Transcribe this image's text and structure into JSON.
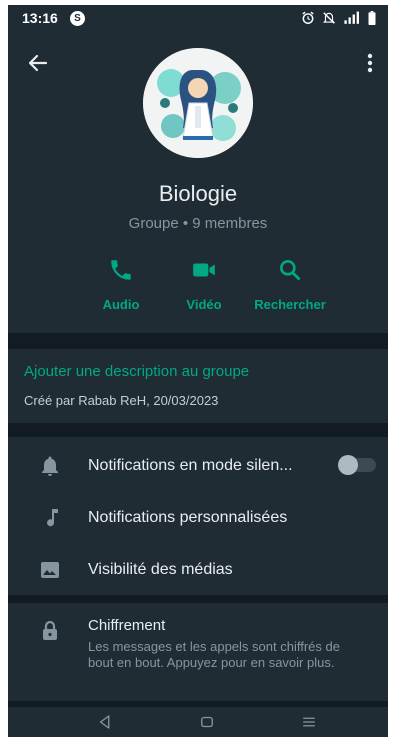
{
  "status_bar": {
    "time": "13:16",
    "s_badge": "S",
    "icons": [
      "alarm-icon",
      "mute-icon",
      "signal-icon",
      "battery-icon"
    ],
    "signal_text": "ᴳₗ"
  },
  "header": {
    "back_icon": "arrow-left-icon",
    "menu_icon": "more-vertical-icon"
  },
  "group": {
    "name": "Biologie",
    "meta": "Groupe • 9 membres"
  },
  "actions": [
    {
      "label": "Audio",
      "icon": "phone-icon"
    },
    {
      "label": "Vidéo",
      "icon": "video-icon"
    },
    {
      "label": "Rechercher",
      "icon": "search-icon"
    }
  ],
  "description": {
    "add_label": "Ajouter une description au groupe",
    "created": "Créé par Rabab ReH, 20/03/2023"
  },
  "settings": [
    {
      "label": "Notifications en mode silen...",
      "icon": "bell-icon",
      "toggle": false
    },
    {
      "label": "Notifications personnalisées",
      "icon": "music-note-icon"
    },
    {
      "label": "Visibilité des médias",
      "icon": "image-icon"
    }
  ],
  "encryption": {
    "title": "Chiffrement",
    "body": "Les messages et les appels sont chiffrés de bout en bout. Appuyez pour en savoir plus.",
    "icon": "lock-icon"
  },
  "colors": {
    "accent": "#00a884",
    "background": "#121b22",
    "surface": "#1f2c34",
    "text_secondary": "#8696a0"
  }
}
